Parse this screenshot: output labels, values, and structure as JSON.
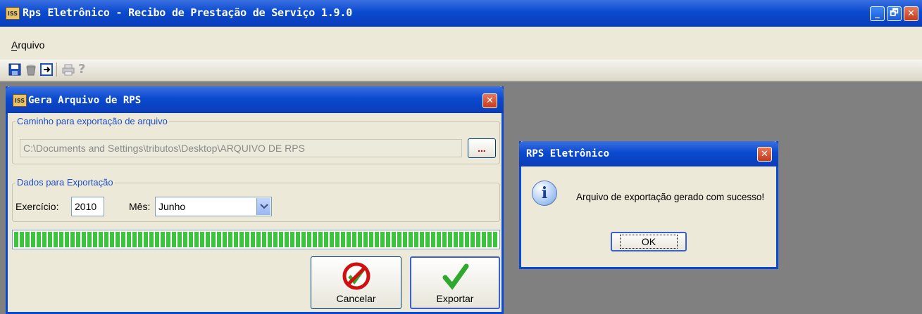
{
  "app": {
    "title": "Rps Eletrônico - Recibo de Prestação de Serviço 1.9.0",
    "icon_label": "ISS",
    "window_controls": {
      "minimize": "_",
      "restore": "🗗",
      "close": "✕"
    }
  },
  "menu": {
    "items": [
      {
        "label": "Arquivo"
      }
    ]
  },
  "toolbar": {
    "icons": [
      "save-icon",
      "trash-icon",
      "export-icon",
      "print-icon",
      "help-icon"
    ]
  },
  "child_window": {
    "title": "Gera Arquivo de RPS",
    "close": "✕",
    "export_path_group": {
      "label": "Caminho para exportação de arquivo",
      "path_value": "C:\\Documents and Settings\\tributos\\Desktop\\ARQUIVO DE RPS",
      "browse_label": "..."
    },
    "export_data_group": {
      "label": "Dados para Exportação",
      "exercicio_label": "Exercício:",
      "exercicio_value": "2010",
      "mes_label": "Mês:",
      "mes_value": "Junho"
    },
    "progress": 1.0,
    "buttons": {
      "cancel": "Cancelar",
      "export": "Exportar"
    }
  },
  "dialog": {
    "title": "RPS Eletrônico",
    "close": "✕",
    "message": "Arquivo de exportação gerado com sucesso!",
    "info_glyph": "i",
    "ok_label": "OK"
  },
  "colors": {
    "titlebar": "#0a4ad0",
    "window_bg": "#ece9d8",
    "desktop": "#808080",
    "progress": "#3cc43c"
  }
}
